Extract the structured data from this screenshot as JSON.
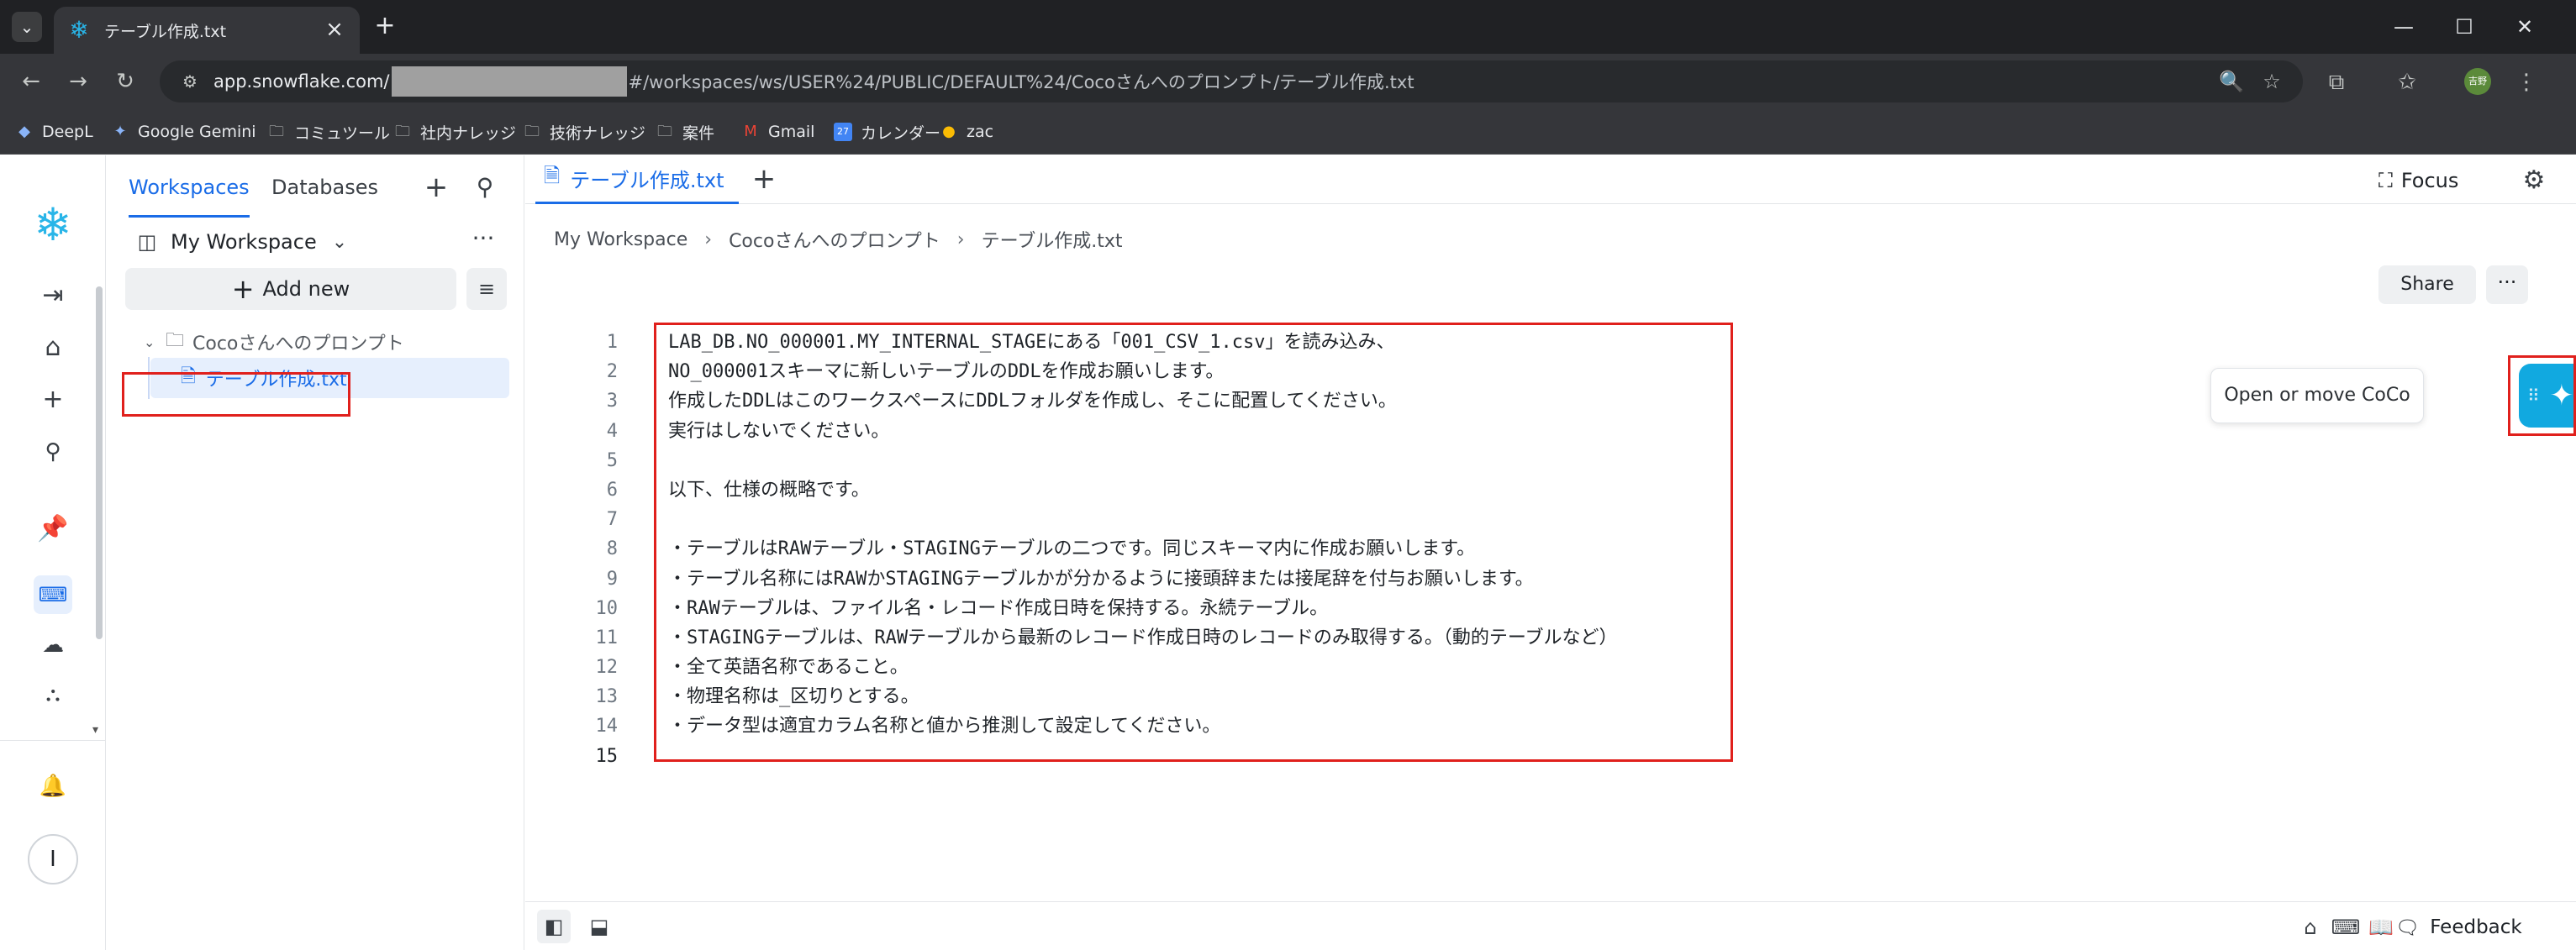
{
  "browser": {
    "tab_title": "テーブル作成.txt",
    "url_host": "app.snowflake.com/",
    "url_path": "#/workspaces/ws/USER%24/PUBLIC/DEFAULT%24/Cocoさんへのプロンプト/テーブル作成.txt",
    "profile_label": "吉野",
    "bookmarks": [
      {
        "label": "DeepL",
        "icon": "deepl-icon"
      },
      {
        "label": "Google Gemini",
        "icon": "gemini-icon"
      },
      {
        "label": "コミュツール",
        "icon": "folder-icon"
      },
      {
        "label": "社内ナレッジ",
        "icon": "folder-icon"
      },
      {
        "label": "技術ナレッジ",
        "icon": "folder-icon"
      },
      {
        "label": "案件",
        "icon": "folder-icon"
      },
      {
        "label": "Gmail",
        "icon": "gmail-icon"
      },
      {
        "label": "カレンダー",
        "icon": "calendar-icon"
      },
      {
        "label": "zac",
        "icon": "zac-icon"
      }
    ],
    "calendar_day": "27"
  },
  "side_panel": {
    "tabs": [
      "Workspaces",
      "Databases"
    ],
    "workspace_name": "My Workspace",
    "add_new_label": "Add new",
    "folder_name": "Cocoさんへのプロンプト",
    "file_name": "テーブル作成.txt"
  },
  "editor": {
    "tab_label": "テーブル作成.txt",
    "focus_label": "Focus",
    "breadcrumb": [
      "My Workspace",
      "Cocoさんへのプロンプト",
      "テーブル作成.txt"
    ],
    "share_label": "Share",
    "lines": [
      {
        "num": "1",
        "text": "LAB_DB.NO_000001.MY_INTERNAL_STAGEにある「001_CSV_1.csv」を読み込み、"
      },
      {
        "num": "2",
        "text": "NO_000001スキーマに新しいテーブルのDDLを作成お願いします。"
      },
      {
        "num": "3",
        "text": "作成したDDLはこのワークスペースにDDLフォルダを作成し、そこに配置してください。"
      },
      {
        "num": "4",
        "text": "実行はしないでください。"
      },
      {
        "num": "5",
        "text": ""
      },
      {
        "num": "6",
        "text": "以下、仕様の概略です。"
      },
      {
        "num": "7",
        "text": ""
      },
      {
        "num": "8",
        "text": "・テーブルはRAWテーブル・STAGINGテーブルの二つです。同じスキーマ内に作成お願いします。"
      },
      {
        "num": "9",
        "text": "・テーブル名称にはRAWかSTAGINGテーブルかが分かるように接頭辞または接尾辞を付与お願いします。"
      },
      {
        "num": "10",
        "text": "・RAWテーブルは、ファイル名・レコード作成日時を保持する。永続テーブル。"
      },
      {
        "num": "11",
        "text": "・STAGINGテーブルは、RAWテーブルから最新のレコード作成日時のレコードのみ取得する。（動的テーブルなど）"
      },
      {
        "num": "12",
        "text": "・全て英語名称であること。"
      },
      {
        "num": "13",
        "text": "・物理名称は_区切りとする。"
      },
      {
        "num": "14",
        "text": "・データ型は適宜カラム名称と値から推測して設定してください。"
      },
      {
        "num": "15",
        "text": ""
      }
    ],
    "active_line": "15"
  },
  "coco": {
    "tooltip": "Open or move CoCo"
  },
  "status_bar": {
    "feedback_label": "Feedback"
  },
  "colors": {
    "accent": "#1a6ce7",
    "snowflake_blue": "#29b5e8",
    "coco_button": "#11a9e0",
    "annotation_red": "#e0201c"
  }
}
